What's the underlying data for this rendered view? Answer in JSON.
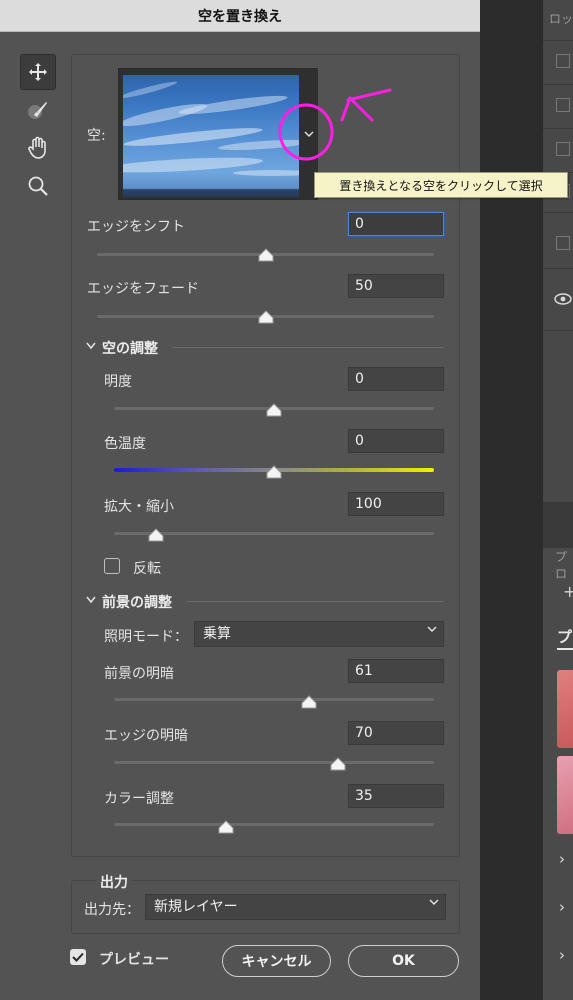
{
  "dialog": {
    "title": "空を置き換え",
    "sky": {
      "label": "空:",
      "tooltip": "置き換えとなる空をクリックして選択"
    },
    "shift_edge": {
      "label": "エッジをシフト",
      "value": "0",
      "slider_fraction": 0.5
    },
    "fade_edge": {
      "label": "エッジをフェード",
      "value": "50",
      "slider_fraction": 0.5
    },
    "sky_adjust": {
      "heading": "空の調整",
      "brightness": {
        "label": "明度",
        "value": "0",
        "slider_fraction": 0.5
      },
      "temperature": {
        "label": "色温度",
        "value": "0",
        "slider_fraction": 0.5
      },
      "scale": {
        "label": "拡大・縮小",
        "value": "100",
        "slider_fraction": 0.13
      },
      "flip": {
        "label": "反転",
        "checked": false
      }
    },
    "fg_adjust": {
      "heading": "前景の調整",
      "lighting_mode": {
        "label": "照明モード：",
        "value": "乗算"
      },
      "fg_lighting": {
        "label": "前景の明暗",
        "value": "61",
        "slider_fraction": 0.61
      },
      "edge_lighting": {
        "label": "エッジの明暗",
        "value": "70",
        "slider_fraction": 0.7
      },
      "color_adjust": {
        "label": "カラー調整",
        "value": "35",
        "slider_fraction": 0.35
      }
    },
    "output": {
      "heading": "出力",
      "dest_label": "出力先：",
      "dest_value": "新規レイヤー"
    },
    "preview": {
      "label": "プレビュー",
      "checked": true
    },
    "cancel_label": "キャンセル",
    "ok_label": "OK"
  },
  "tools": [
    "move-tool",
    "sky-brush-tool",
    "hand-tool",
    "zoom-tool"
  ],
  "background_panels": {
    "layers_tab": "ロッ",
    "properties_tab": "プロ",
    "properties_subtab": "プ"
  },
  "annotation_color": "#ff1ee6"
}
